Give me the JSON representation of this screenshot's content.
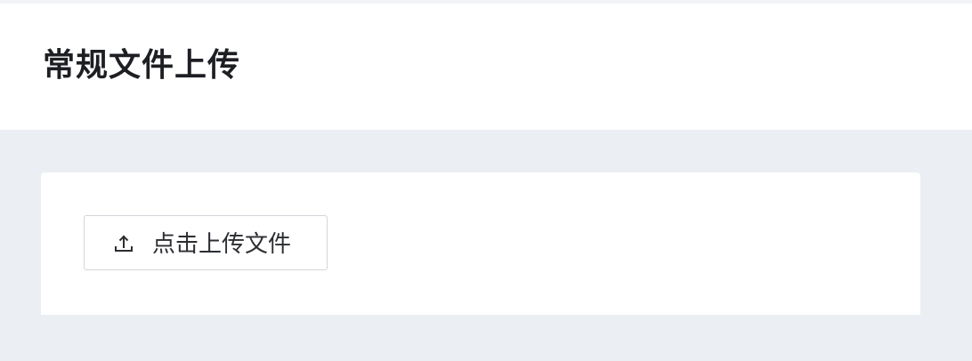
{
  "page": {
    "title": "常规文件上传"
  },
  "upload": {
    "button_label": "点击上传文件",
    "icon": "upload-icon"
  },
  "colors": {
    "page_background": "#ebeef2",
    "card_background": "#ffffff",
    "button_border": "#d3d6dc",
    "title_text": "#1d1f23"
  }
}
